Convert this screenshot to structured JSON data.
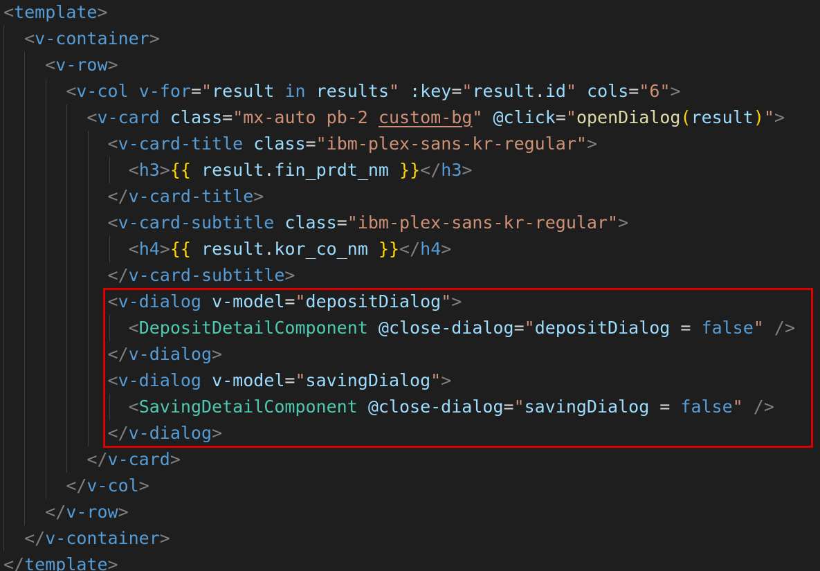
{
  "code_lines": [
    {
      "segments": [
        {
          "t": "<",
          "c": "t-punc"
        },
        {
          "t": "template",
          "c": "t-tag"
        },
        {
          "t": ">",
          "c": "t-punc"
        }
      ]
    },
    {
      "segments": [
        {
          "t": "  ",
          "c": "t-text"
        },
        {
          "t": "<",
          "c": "t-punc"
        },
        {
          "t": "v-container",
          "c": "t-tag"
        },
        {
          "t": ">",
          "c": "t-punc"
        }
      ]
    },
    {
      "segments": [
        {
          "t": "    ",
          "c": "t-text"
        },
        {
          "t": "<",
          "c": "t-punc"
        },
        {
          "t": "v-row",
          "c": "t-tag"
        },
        {
          "t": ">",
          "c": "t-punc"
        }
      ]
    },
    {
      "segments": [
        {
          "t": "      ",
          "c": "t-text"
        },
        {
          "t": "<",
          "c": "t-punc"
        },
        {
          "t": "v-col",
          "c": "t-tag"
        },
        {
          "t": " ",
          "c": "t-text"
        },
        {
          "t": "v-for",
          "c": "t-kw"
        },
        {
          "t": "=",
          "c": "t-eq"
        },
        {
          "t": "\"",
          "c": "t-str"
        },
        {
          "t": "result",
          "c": "t-var"
        },
        {
          "t": " ",
          "c": "t-text"
        },
        {
          "t": "in",
          "c": "t-kw"
        },
        {
          "t": " ",
          "c": "t-text"
        },
        {
          "t": "results",
          "c": "t-var"
        },
        {
          "t": "\"",
          "c": "t-str"
        },
        {
          "t": " ",
          "c": "t-text"
        },
        {
          "t": ":key",
          "c": "t-attr"
        },
        {
          "t": "=",
          "c": "t-eq"
        },
        {
          "t": "\"",
          "c": "t-str"
        },
        {
          "t": "result",
          "c": "t-var"
        },
        {
          "t": ".",
          "c": "t-text"
        },
        {
          "t": "id",
          "c": "t-var"
        },
        {
          "t": "\"",
          "c": "t-str"
        },
        {
          "t": " ",
          "c": "t-text"
        },
        {
          "t": "cols",
          "c": "t-attr"
        },
        {
          "t": "=",
          "c": "t-eq"
        },
        {
          "t": "\"6\"",
          "c": "t-str"
        },
        {
          "t": ">",
          "c": "t-punc"
        }
      ]
    },
    {
      "segments": [
        {
          "t": "        ",
          "c": "t-text"
        },
        {
          "t": "<",
          "c": "t-punc"
        },
        {
          "t": "v-card",
          "c": "t-tag"
        },
        {
          "t": " ",
          "c": "t-text"
        },
        {
          "t": "class",
          "c": "t-attr"
        },
        {
          "t": "=",
          "c": "t-eq"
        },
        {
          "t": "\"mx-auto pb-2 ",
          "c": "t-str"
        },
        {
          "t": "custom-bg",
          "c": "t-str-under"
        },
        {
          "t": "\"",
          "c": "t-str"
        },
        {
          "t": " ",
          "c": "t-text"
        },
        {
          "t": "@click",
          "c": "t-attr"
        },
        {
          "t": "=",
          "c": "t-eq"
        },
        {
          "t": "\"",
          "c": "t-str"
        },
        {
          "t": "openDialog",
          "c": "t-fn"
        },
        {
          "t": "(",
          "c": "t-brace"
        },
        {
          "t": "result",
          "c": "t-var"
        },
        {
          "t": ")",
          "c": "t-brace"
        },
        {
          "t": "\"",
          "c": "t-str"
        },
        {
          "t": ">",
          "c": "t-punc"
        }
      ]
    },
    {
      "segments": [
        {
          "t": "          ",
          "c": "t-text"
        },
        {
          "t": "<",
          "c": "t-punc"
        },
        {
          "t": "v-card-title",
          "c": "t-tag"
        },
        {
          "t": " ",
          "c": "t-text"
        },
        {
          "t": "class",
          "c": "t-attr"
        },
        {
          "t": "=",
          "c": "t-eq"
        },
        {
          "t": "\"ibm-plex-sans-kr-regular\"",
          "c": "t-str"
        },
        {
          "t": ">",
          "c": "t-punc"
        }
      ]
    },
    {
      "segments": [
        {
          "t": "            ",
          "c": "t-text"
        },
        {
          "t": "<",
          "c": "t-punc"
        },
        {
          "t": "h3",
          "c": "t-tag"
        },
        {
          "t": ">",
          "c": "t-punc"
        },
        {
          "t": "{{",
          "c": "t-brace"
        },
        {
          "t": " ",
          "c": "t-text"
        },
        {
          "t": "result",
          "c": "t-var"
        },
        {
          "t": ".",
          "c": "t-text"
        },
        {
          "t": "fin_prdt_nm",
          "c": "t-var"
        },
        {
          "t": " ",
          "c": "t-text"
        },
        {
          "t": "}}",
          "c": "t-brace"
        },
        {
          "t": "</",
          "c": "t-punc"
        },
        {
          "t": "h3",
          "c": "t-tag"
        },
        {
          "t": ">",
          "c": "t-punc"
        }
      ]
    },
    {
      "segments": [
        {
          "t": "          ",
          "c": "t-text"
        },
        {
          "t": "</",
          "c": "t-punc"
        },
        {
          "t": "v-card-title",
          "c": "t-tag"
        },
        {
          "t": ">",
          "c": "t-punc"
        }
      ]
    },
    {
      "segments": [
        {
          "t": "          ",
          "c": "t-text"
        },
        {
          "t": "<",
          "c": "t-punc"
        },
        {
          "t": "v-card-subtitle",
          "c": "t-tag"
        },
        {
          "t": " ",
          "c": "t-text"
        },
        {
          "t": "class",
          "c": "t-attr"
        },
        {
          "t": "=",
          "c": "t-eq"
        },
        {
          "t": "\"ibm-plex-sans-kr-regular\"",
          "c": "t-str"
        },
        {
          "t": ">",
          "c": "t-punc"
        }
      ]
    },
    {
      "segments": [
        {
          "t": "            ",
          "c": "t-text"
        },
        {
          "t": "<",
          "c": "t-punc"
        },
        {
          "t": "h4",
          "c": "t-tag"
        },
        {
          "t": ">",
          "c": "t-punc"
        },
        {
          "t": "{{",
          "c": "t-brace"
        },
        {
          "t": " ",
          "c": "t-text"
        },
        {
          "t": "result",
          "c": "t-var"
        },
        {
          "t": ".",
          "c": "t-text"
        },
        {
          "t": "kor_co_nm",
          "c": "t-var"
        },
        {
          "t": " ",
          "c": "t-text"
        },
        {
          "t": "}}",
          "c": "t-brace"
        },
        {
          "t": "</",
          "c": "t-punc"
        },
        {
          "t": "h4",
          "c": "t-tag"
        },
        {
          "t": ">",
          "c": "t-punc"
        }
      ]
    },
    {
      "segments": [
        {
          "t": "          ",
          "c": "t-text"
        },
        {
          "t": "</",
          "c": "t-punc"
        },
        {
          "t": "v-card-subtitle",
          "c": "t-tag"
        },
        {
          "t": ">",
          "c": "t-punc"
        }
      ]
    },
    {
      "segments": [
        {
          "t": "          ",
          "c": "t-text"
        },
        {
          "t": "<",
          "c": "t-punc"
        },
        {
          "t": "v-dialog",
          "c": "t-tag"
        },
        {
          "t": " ",
          "c": "t-text"
        },
        {
          "t": "v-model",
          "c": "t-attr"
        },
        {
          "t": "=",
          "c": "t-eq"
        },
        {
          "t": "\"",
          "c": "t-str"
        },
        {
          "t": "depositDialog",
          "c": "t-var"
        },
        {
          "t": "\"",
          "c": "t-str"
        },
        {
          "t": ">",
          "c": "t-punc"
        }
      ]
    },
    {
      "segments": [
        {
          "t": "            ",
          "c": "t-text"
        },
        {
          "t": "<",
          "c": "t-punc"
        },
        {
          "t": "DepositDetailComponent",
          "c": "t-comp"
        },
        {
          "t": " ",
          "c": "t-text"
        },
        {
          "t": "@close-dialog",
          "c": "t-attr"
        },
        {
          "t": "=",
          "c": "t-eq"
        },
        {
          "t": "\"",
          "c": "t-str"
        },
        {
          "t": "depositDialog",
          "c": "t-var"
        },
        {
          "t": " = ",
          "c": "t-text"
        },
        {
          "t": "false",
          "c": "t-kw"
        },
        {
          "t": "\"",
          "c": "t-str"
        },
        {
          "t": " ",
          "c": "t-text"
        },
        {
          "t": "/>",
          "c": "t-punc"
        }
      ]
    },
    {
      "segments": [
        {
          "t": "          ",
          "c": "t-text"
        },
        {
          "t": "</",
          "c": "t-punc"
        },
        {
          "t": "v-dialog",
          "c": "t-tag"
        },
        {
          "t": ">",
          "c": "t-punc"
        }
      ]
    },
    {
      "segments": [
        {
          "t": "          ",
          "c": "t-text"
        },
        {
          "t": "<",
          "c": "t-punc"
        },
        {
          "t": "v-dialog",
          "c": "t-tag"
        },
        {
          "t": " ",
          "c": "t-text"
        },
        {
          "t": "v-model",
          "c": "t-attr"
        },
        {
          "t": "=",
          "c": "t-eq"
        },
        {
          "t": "\"",
          "c": "t-str"
        },
        {
          "t": "savingDialog",
          "c": "t-var"
        },
        {
          "t": "\"",
          "c": "t-str"
        },
        {
          "t": ">",
          "c": "t-punc"
        }
      ]
    },
    {
      "segments": [
        {
          "t": "            ",
          "c": "t-text"
        },
        {
          "t": "<",
          "c": "t-punc"
        },
        {
          "t": "SavingDetailComponent",
          "c": "t-comp"
        },
        {
          "t": " ",
          "c": "t-text"
        },
        {
          "t": "@close-dialog",
          "c": "t-attr"
        },
        {
          "t": "=",
          "c": "t-eq"
        },
        {
          "t": "\"",
          "c": "t-str"
        },
        {
          "t": "savingDialog",
          "c": "t-var"
        },
        {
          "t": " = ",
          "c": "t-text"
        },
        {
          "t": "false",
          "c": "t-kw"
        },
        {
          "t": "\"",
          "c": "t-str"
        },
        {
          "t": " ",
          "c": "t-text"
        },
        {
          "t": "/>",
          "c": "t-punc"
        }
      ]
    },
    {
      "segments": [
        {
          "t": "          ",
          "c": "t-text"
        },
        {
          "t": "</",
          "c": "t-punc"
        },
        {
          "t": "v-dialog",
          "c": "t-tag"
        },
        {
          "t": ">",
          "c": "t-punc"
        }
      ]
    },
    {
      "segments": [
        {
          "t": "        ",
          "c": "t-text"
        },
        {
          "t": "</",
          "c": "t-punc"
        },
        {
          "t": "v-card",
          "c": "t-tag"
        },
        {
          "t": ">",
          "c": "t-punc"
        }
      ]
    },
    {
      "segments": [
        {
          "t": "      ",
          "c": "t-text"
        },
        {
          "t": "</",
          "c": "t-punc"
        },
        {
          "t": "v-col",
          "c": "t-tag"
        },
        {
          "t": ">",
          "c": "t-punc"
        }
      ]
    },
    {
      "segments": [
        {
          "t": "    ",
          "c": "t-text"
        },
        {
          "t": "</",
          "c": "t-punc"
        },
        {
          "t": "v-row",
          "c": "t-tag"
        },
        {
          "t": ">",
          "c": "t-punc"
        }
      ]
    },
    {
      "segments": [
        {
          "t": "  ",
          "c": "t-text"
        },
        {
          "t": "</",
          "c": "t-punc"
        },
        {
          "t": "v-container",
          "c": "t-tag"
        },
        {
          "t": ">",
          "c": "t-punc"
        }
      ]
    },
    {
      "segments": [
        {
          "t": "</",
          "c": "t-punc"
        },
        {
          "t": "template",
          "c": "t-tag"
        },
        {
          "t": ">",
          "c": "t-punc"
        }
      ]
    }
  ],
  "colors": {
    "background": "#1e1e1e",
    "highlight_border": "#e00000"
  }
}
